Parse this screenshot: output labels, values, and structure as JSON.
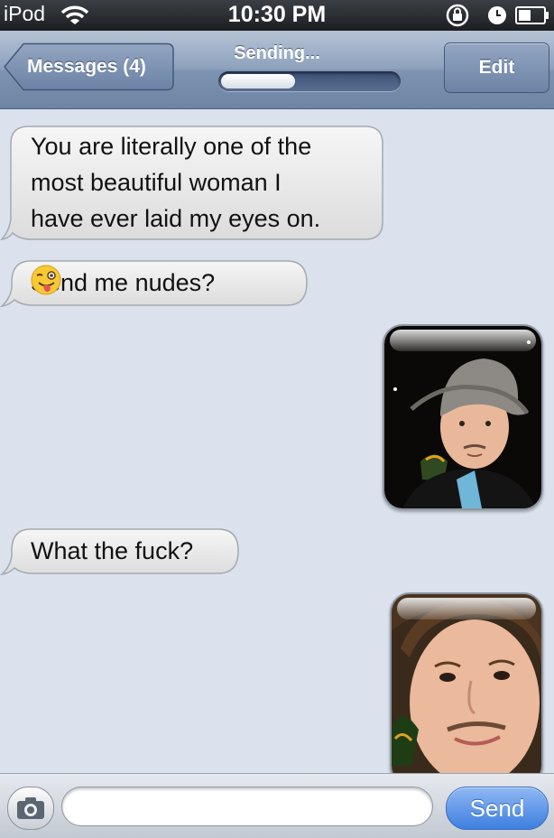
{
  "status_bar": {
    "carrier": "iPod",
    "time": "10:30 PM",
    "icons": [
      "wifi-icon",
      "rotation-lock-icon",
      "alarm-icon",
      "battery-icon"
    ]
  },
  "navigation": {
    "back_label": "Messages (4)",
    "status_text": "Sending...",
    "progress": 0.42,
    "edit_label": "Edit"
  },
  "messages": [
    {
      "direction": "incoming",
      "type": "text",
      "lines": [
        "You are literally one of the",
        "most beautiful woman I",
        "have ever laid my eyes on."
      ]
    },
    {
      "direction": "incoming",
      "type": "text",
      "text": "Send me nudes?",
      "emoji": "winking-face-tongue-icon"
    },
    {
      "direction": "outgoing",
      "type": "photo",
      "subject": "man-in-bucket-hat-photo"
    },
    {
      "direction": "incoming",
      "type": "text",
      "text": "What the fuck?"
    },
    {
      "direction": "outgoing",
      "type": "photo",
      "subject": "man-closeup-photo"
    }
  ],
  "input_bar": {
    "camera_icon": "camera-icon",
    "placeholder": "",
    "send_label": "Send"
  },
  "colors": {
    "thread_background": "#dbe2ed",
    "navbar": "#7d93b1",
    "send_button": "#3e7fe0",
    "incoming_bubble": "#e6e6e6"
  }
}
